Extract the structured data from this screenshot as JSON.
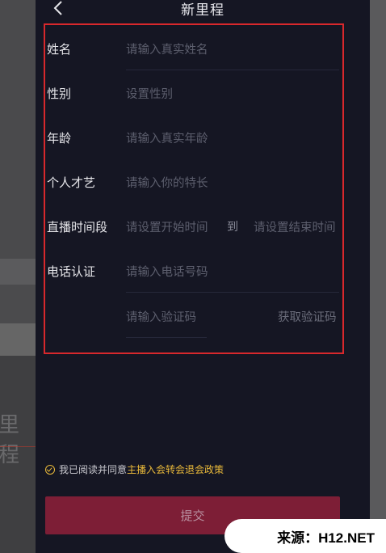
{
  "header": {
    "title": "新里程"
  },
  "form": {
    "name": {
      "label": "姓名",
      "placeholder": "请输入真实姓名"
    },
    "gender": {
      "label": "性别",
      "placeholder": "设置性别"
    },
    "age": {
      "label": "年龄",
      "placeholder": "请输入真实年龄"
    },
    "talent": {
      "label": "个人才艺",
      "placeholder": "请输入你的特长"
    },
    "live_time": {
      "label": "直播时间段",
      "start_placeholder": "请设置开始时间",
      "to_text": "到",
      "end_placeholder": "请设置结束时间"
    },
    "phone": {
      "label": "电话认证",
      "placeholder": "请输入电话号码"
    },
    "code": {
      "placeholder": "请输入验证码",
      "get_code": "获取验证码"
    }
  },
  "agreement": {
    "prefix": "我已阅读并同意",
    "link": "主播入会转会退会政策"
  },
  "submit_label": "提交",
  "watermark": "来源：H12.NET",
  "background": {
    "ghost_text": "里程"
  },
  "colors": {
    "accent": "#e9b93a",
    "submit_bg": "#7d1e36",
    "highlight_box": "#d8282c",
    "page_bg": "#151623"
  }
}
